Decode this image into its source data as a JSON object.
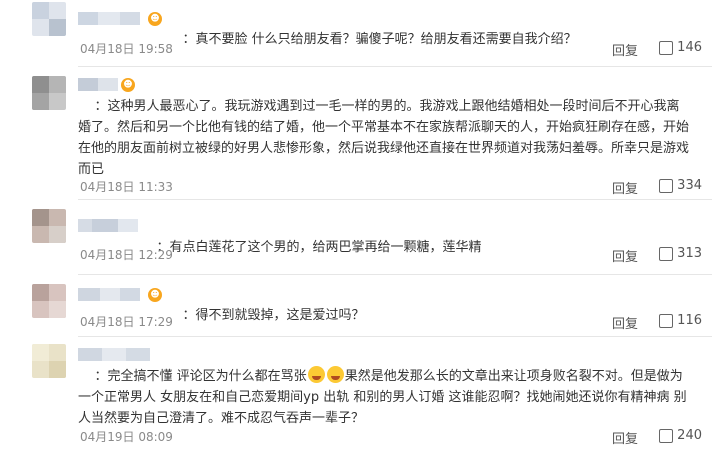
{
  "comments": [
    {
      "vip": "☻",
      "text": "真不要脸 什么只给朋友看？骗傻子呢？给朋友看还需要自我介绍？",
      "time": "04月18日 19:58",
      "reply": "回复",
      "likes": "146"
    },
    {
      "vip": "☻",
      "text": "这种男人最恶心了。我玩游戏遇到过一毛一样的男的。我游戏上跟他结婚相处一段时间后不开心我离婚了。然后和另一个比他有钱的结了婚，他一个平常基本不在家族帮派聊天的人，开始疯狂刷存在感，开始在他的朋友面前树立被绿的好男人悲惨形象，然后说我绿他还直接在世界频道对我荡妇羞辱。所幸只是游戏而已",
      "time": "04月18日 11:33",
      "reply": "回复",
      "likes": "334"
    },
    {
      "vip": "",
      "text": "有点白莲花了这个男的，给两巴掌再给一颗糖，莲华精",
      "time": "04月18日 12:29",
      "reply": "回复",
      "likes": "313"
    },
    {
      "vip": "☻",
      "text": "得不到就毁掉，这是爱过吗？",
      "time": "04月18日 17:29",
      "reply": "回复",
      "likes": "116"
    },
    {
      "vip": "",
      "text_part1": "完全搞不懂 评论区为什么都在骂张",
      "text_part2": "果然是他发那么长的文章出来让项身败名裂不对。但是做为一个正常男人 女朋友在和自己恋爱期间yp 出轨 和别的男人订婚 这谁能忍啊？找她闹她还说你有精神病 别人当然要为自己澄清了。难不成忍气吞声一辈子？",
      "time": "04月19日 08:09",
      "reply": "回复",
      "likes": "240"
    }
  ]
}
